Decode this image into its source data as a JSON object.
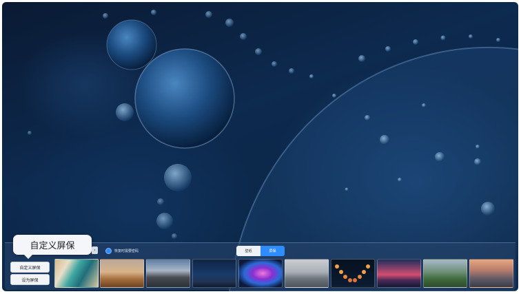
{
  "popover": {
    "title": "自定义屏保"
  },
  "toolbar": {
    "checkbox_label": "恢复时需要密码",
    "toggle": {
      "left": "壁纸",
      "right": "屏保"
    }
  },
  "side_buttons": {
    "custom": "自定义屏保",
    "set_as": "设为屏保"
  },
  "thumbnails": [
    {
      "name": "coast-aerial"
    },
    {
      "name": "desert-dunes"
    },
    {
      "name": "mountain-cabin"
    },
    {
      "name": "night-sky"
    },
    {
      "name": "abstract-color"
    },
    {
      "name": "foggy-sea"
    },
    {
      "name": "moon-phases"
    },
    {
      "name": "sunset-sea"
    },
    {
      "name": "green-valley"
    },
    {
      "name": "yosemite-dusk"
    }
  ],
  "colors": {
    "accent": "#2f8cff",
    "bar": "#2a4a72"
  }
}
